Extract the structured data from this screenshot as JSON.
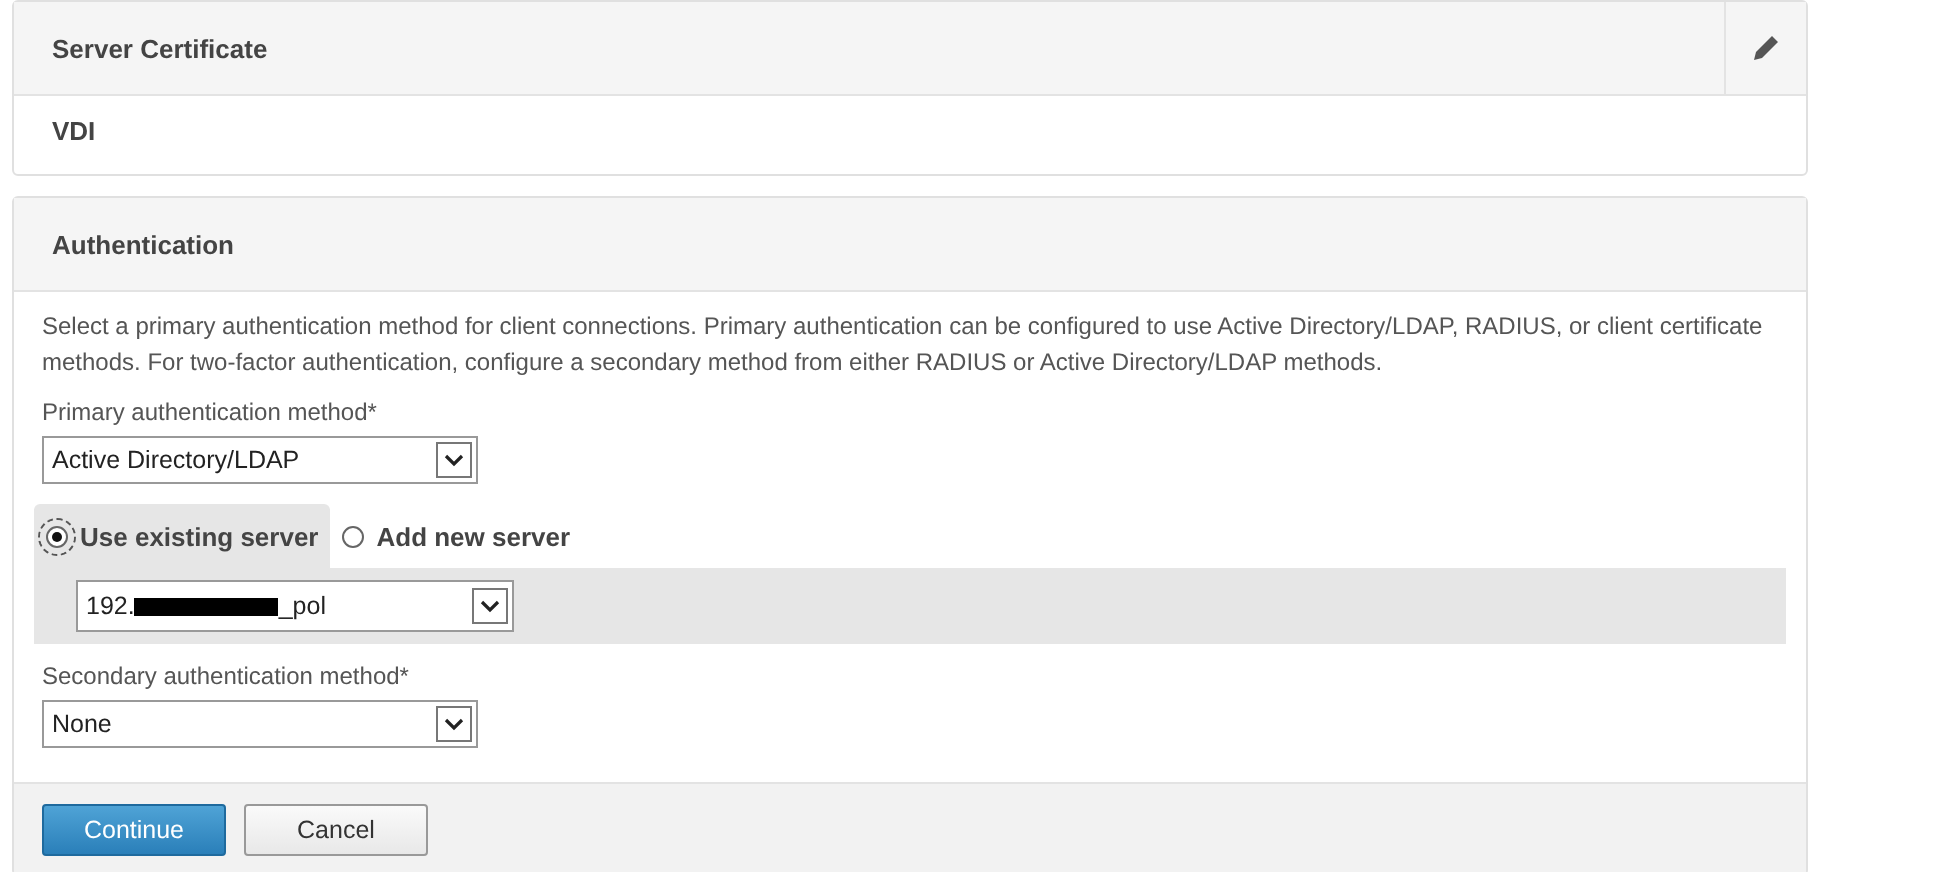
{
  "certificate_panel": {
    "title": "Server Certificate",
    "value": "VDI"
  },
  "authentication_panel": {
    "title": "Authentication",
    "description": "Select a primary authentication method for client connections. Primary authentication can be configured to use Active Directory/LDAP, RADIUS, or client certificate methods. For two-factor authentication, configure a secondary method from either RADIUS or Active Directory/LDAP methods.",
    "primary": {
      "label": "Primary authentication method*",
      "value": "Active Directory/LDAP"
    },
    "server_options": [
      {
        "label": "Use existing server",
        "selected": true
      },
      {
        "label": "Add new server",
        "selected": false
      }
    ],
    "server": {
      "value_start": "192.",
      "redacted": true,
      "value_end": "_pol"
    },
    "secondary": {
      "label": "Secondary authentication method*",
      "value": "None"
    },
    "buttons": [
      {
        "label": "Continue",
        "kind": "primary"
      },
      {
        "label": "Cancel",
        "kind": "secondary"
      }
    ]
  }
}
